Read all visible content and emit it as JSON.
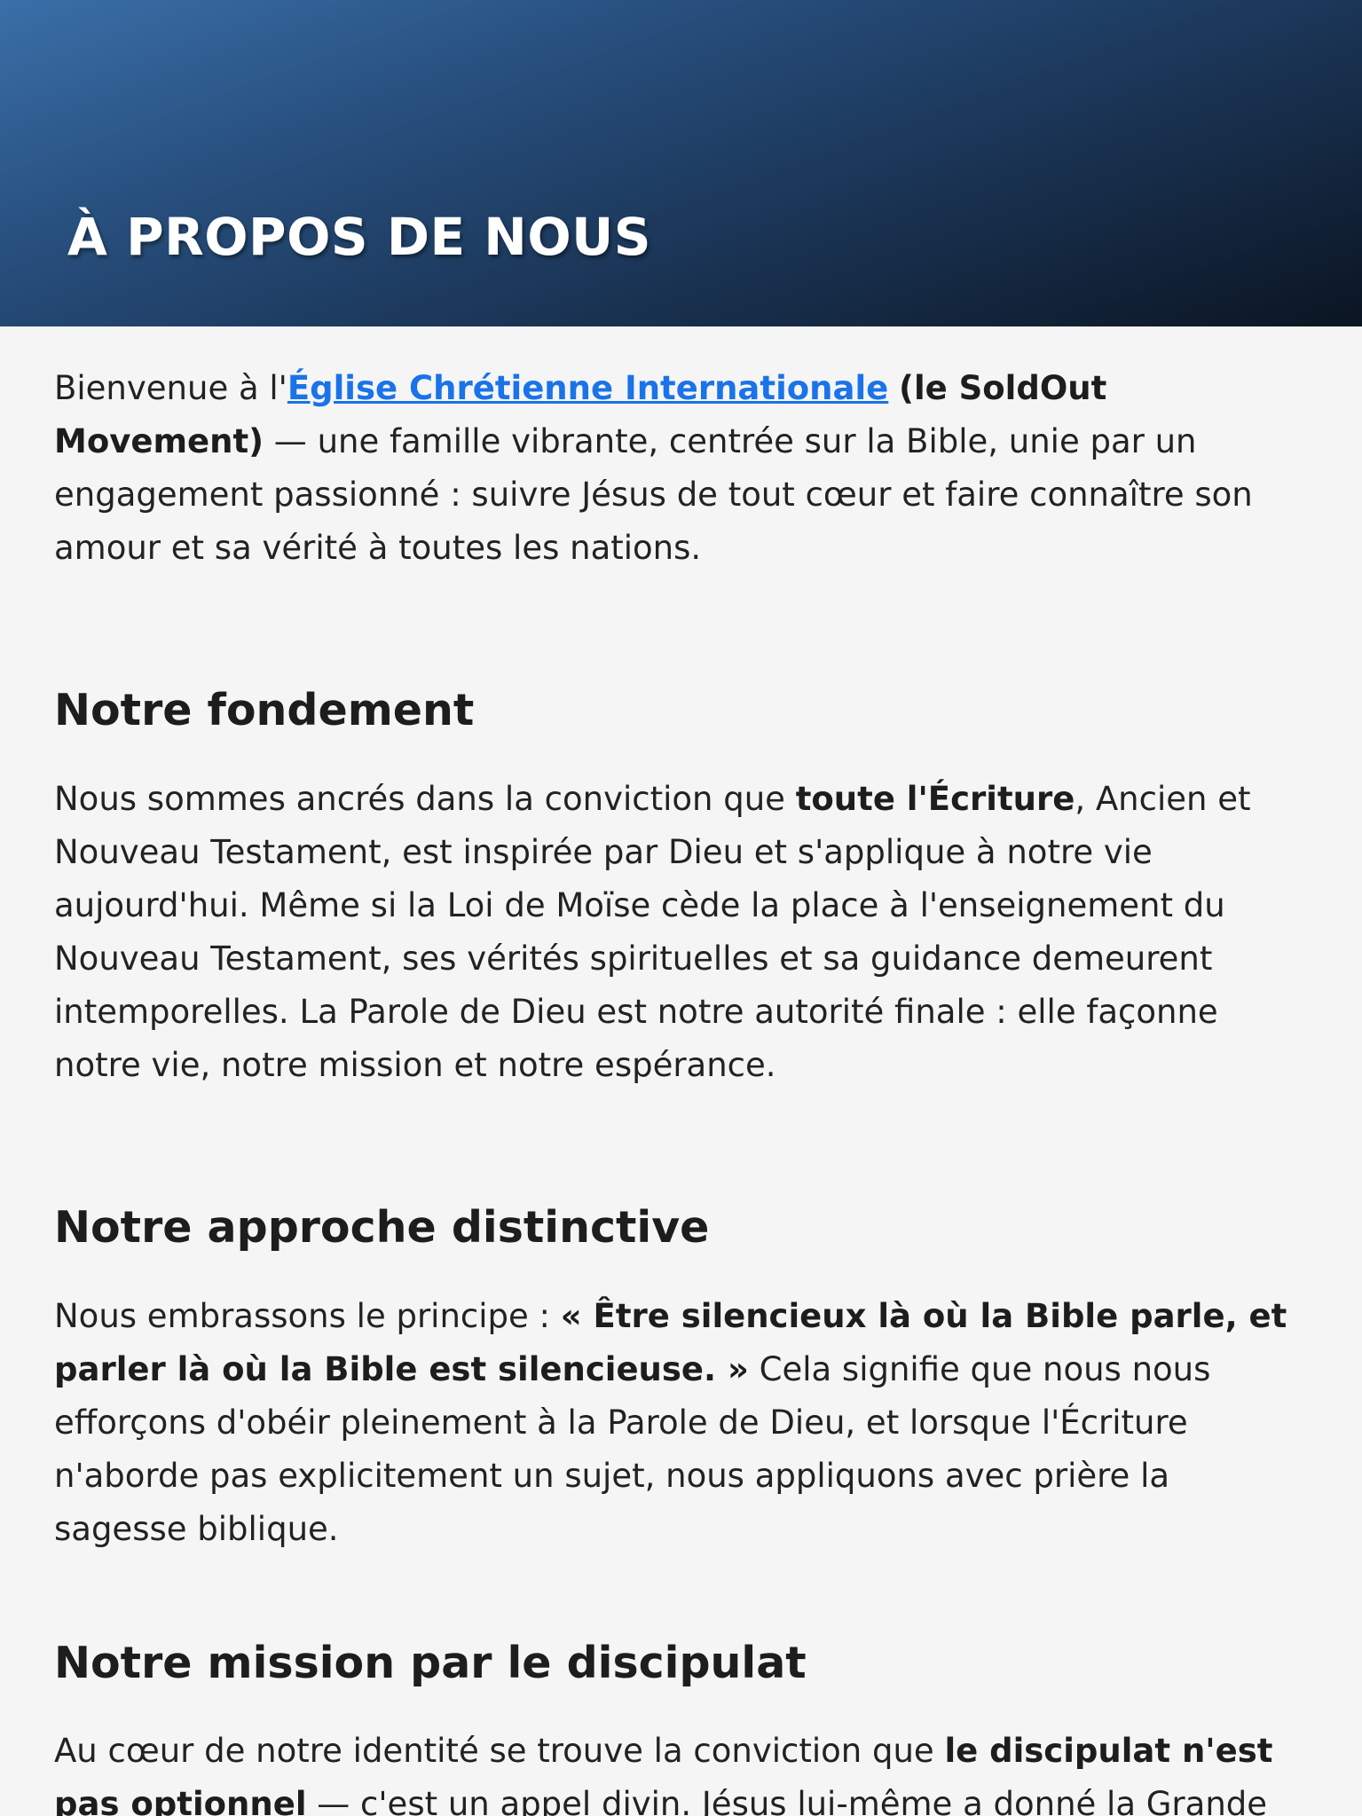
{
  "hero": {
    "title": "À PROPOS DE NOUS"
  },
  "intro": {
    "prefix": "Bienvenue à l'",
    "link_text": "Église Chrétienne Internationale",
    "bold_text": "(le SoldOut Movement)",
    "suffix": " — une famille vibrante, centrée sur la Bible, unie par un engagement passionné : suivre Jésus de tout cœur et faire connaître son amour et sa vérité à toutes les nations."
  },
  "sections": [
    {
      "heading": "Notre fondement",
      "parts": {
        "before": "Nous sommes ancrés dans la conviction que ",
        "bold": "toute l'Écriture",
        "after": ", Ancien et Nouveau Testament, est inspirée par Dieu et s'applique à notre vie aujourd'hui. Même si la Loi de Moïse cède la place à l'enseignement du Nouveau Testament, ses vérités spirituelles et sa guidance demeurent intemporelles. La Parole de Dieu est notre autorité finale : elle façonne notre vie, notre mission et notre espérance."
      }
    },
    {
      "heading": "Notre approche distinctive",
      "parts": {
        "before": "Nous embrassons le principe : ",
        "bold": "« Être silencieux là où la Bible parle, et parler là où la Bible est silencieuse. »",
        "after": " Cela signifie que nous nous efforçons d'obéir pleinement à la Parole de Dieu, et lorsque l'Écriture n'aborde pas explicitement un sujet, nous appliquons avec prière la sagesse biblique."
      }
    },
    {
      "heading": "Notre mission par le discipulat",
      "parts": {
        "before": "Au cœur de notre identité se trouve la conviction que ",
        "bold": "le discipulat n'est pas optionnel",
        "after": " — c'est un appel divin. Jésus lui-même a donné la Grande"
      }
    }
  ],
  "colors": {
    "link": "#1a73e8",
    "background": "#f5f5f5",
    "hero_gradient_start": "#3a6fa8",
    "hero_gradient_end": "#0b1522"
  }
}
